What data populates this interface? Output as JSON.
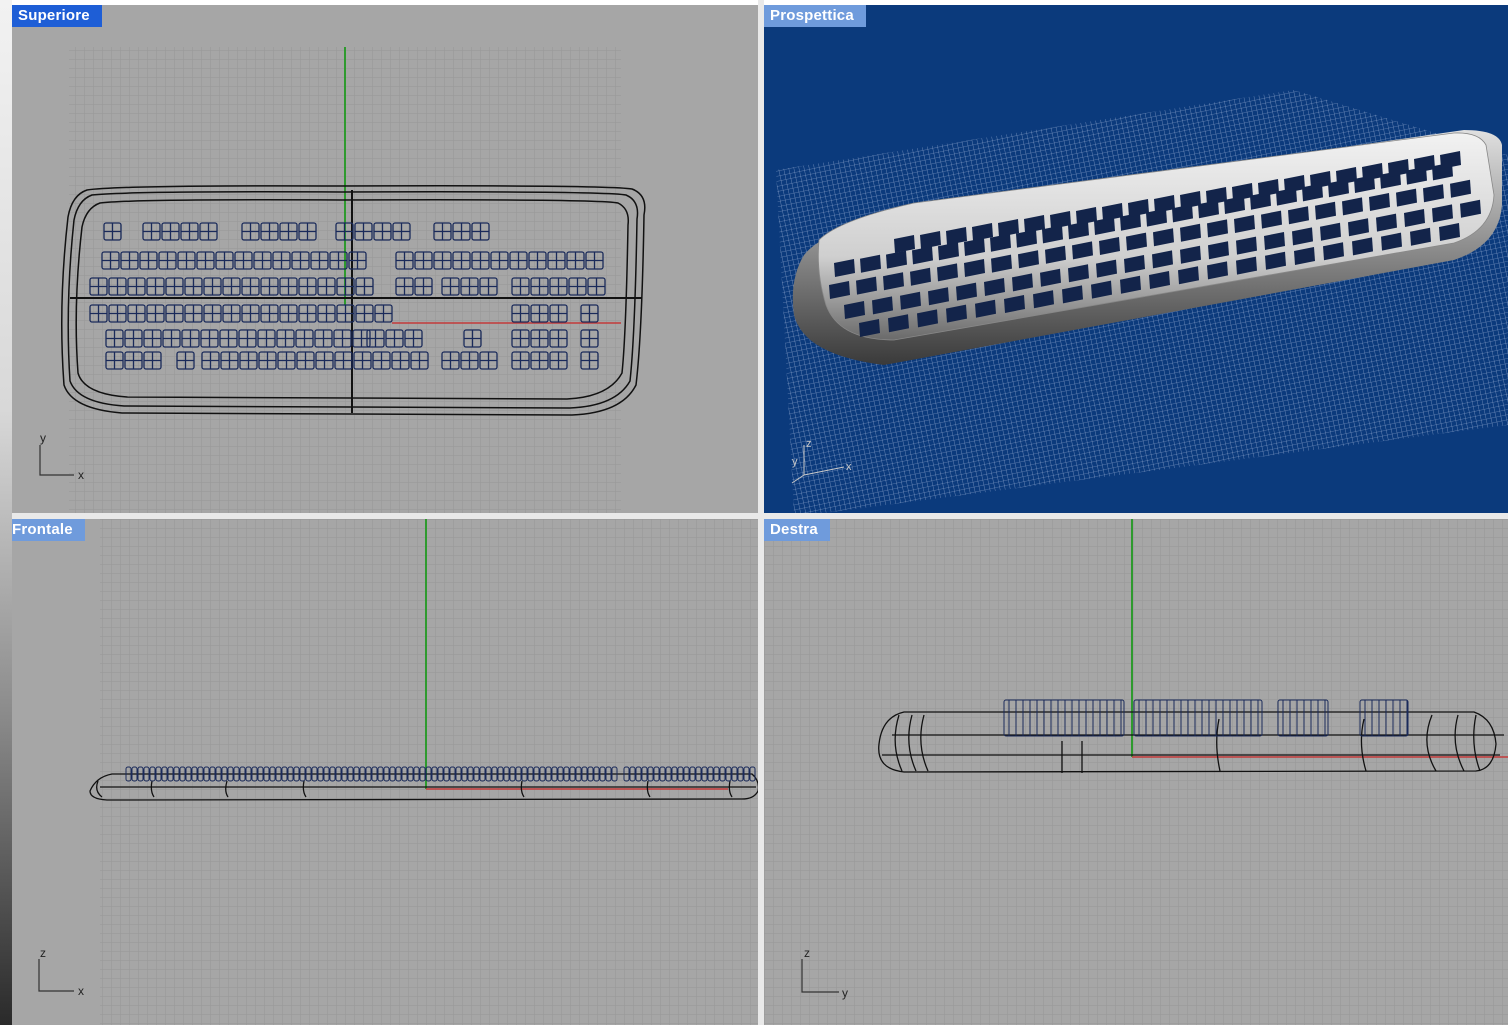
{
  "viewports": {
    "top": {
      "label": "Superiore",
      "axis_v": "y",
      "axis_h": "x"
    },
    "persp": {
      "label": "Prospettica",
      "axis_v": "z",
      "axis_h": "x",
      "axis_3": "y"
    },
    "front": {
      "label": "Frontale",
      "axis_v": "z",
      "axis_h": "x"
    },
    "right": {
      "label": "Destra",
      "axis_v": "z",
      "axis_h": "y"
    }
  },
  "colors": {
    "viewport_bg": "#a6a6a6",
    "grid": "#9a9a9a",
    "perspective_bg": "#0b3a7c",
    "active_label": "#1e5ed6",
    "inactive_label": "#6f9bdc",
    "y_axis": "#2e9a2e",
    "x_axis": "#c43a3a",
    "keys": "#13244a"
  },
  "icons": {
    "axis_gizmo": "axis-gizmo-icon"
  }
}
